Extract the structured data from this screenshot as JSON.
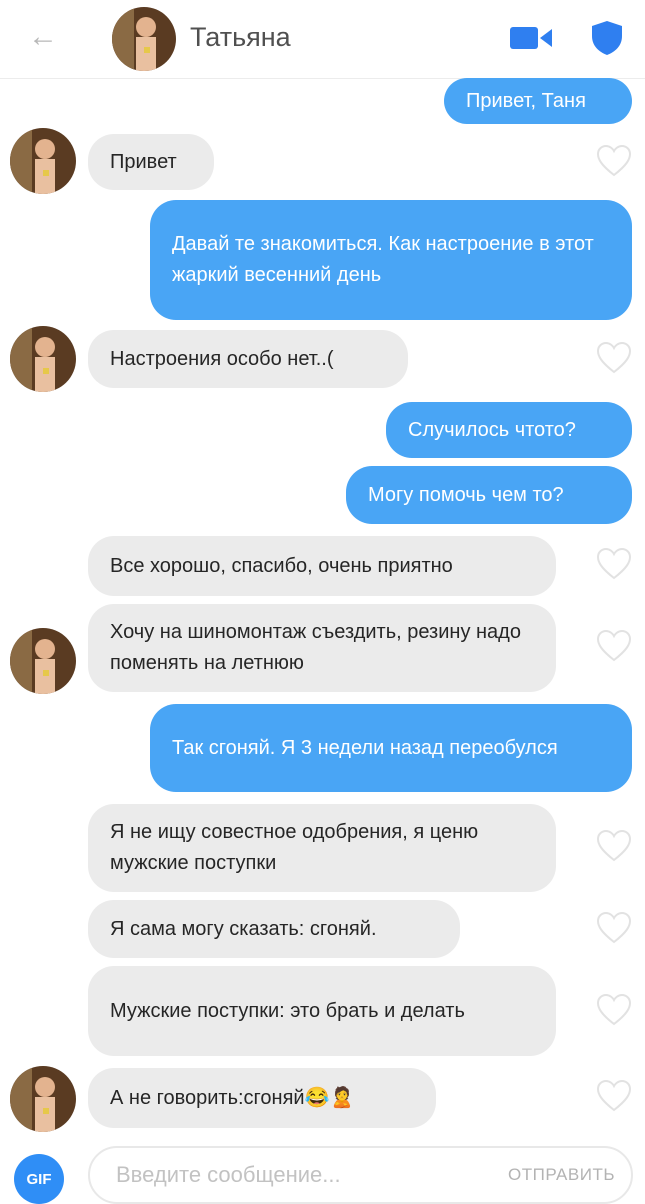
{
  "header": {
    "back_icon": "arrow-left-icon",
    "contact_name": "Татьяна",
    "video_icon": "video-camera-icon",
    "shield_icon": "shield-icon",
    "accent_color": "#2f7ff0"
  },
  "messages": [
    {
      "from": "me",
      "text": "Привет, Таня"
    },
    {
      "from": "her",
      "text": "Привет"
    },
    {
      "from": "me",
      "text": "Давай те знакомиться. Как настроение в этот жаркий весенний день"
    },
    {
      "from": "her",
      "text": "Настроения особо нет..("
    },
    {
      "from": "me",
      "text": "Случилось чтото?"
    },
    {
      "from": "me",
      "text": "Могу помочь чем то?"
    },
    {
      "from": "her",
      "text": "Все хорошо, спасибо, очень приятно"
    },
    {
      "from": "her",
      "text": "Хочу на шиномонтаж съездить, резину надо поменять на летнюю"
    },
    {
      "from": "me",
      "text": "Так сгоняй. Я 3 недели назад переобулся"
    },
    {
      "from": "her",
      "text": "Я не ищу совестное одобрения, я ценю мужские поступки"
    },
    {
      "from": "her",
      "text": "Я сама могу сказать: сгоняй."
    },
    {
      "from": "her",
      "text": "Мужские поступки: это брать и делать"
    },
    {
      "from": "her",
      "text": "А не говорить:сгоняй😂🙎"
    }
  ],
  "composer": {
    "gif_label": "GIF",
    "placeholder": "Введите сообщение...",
    "send_label": "ОТПРАВИТЬ"
  },
  "colors": {
    "outgoing_bubble": "#49a5f5",
    "incoming_bubble": "#ebebeb"
  }
}
